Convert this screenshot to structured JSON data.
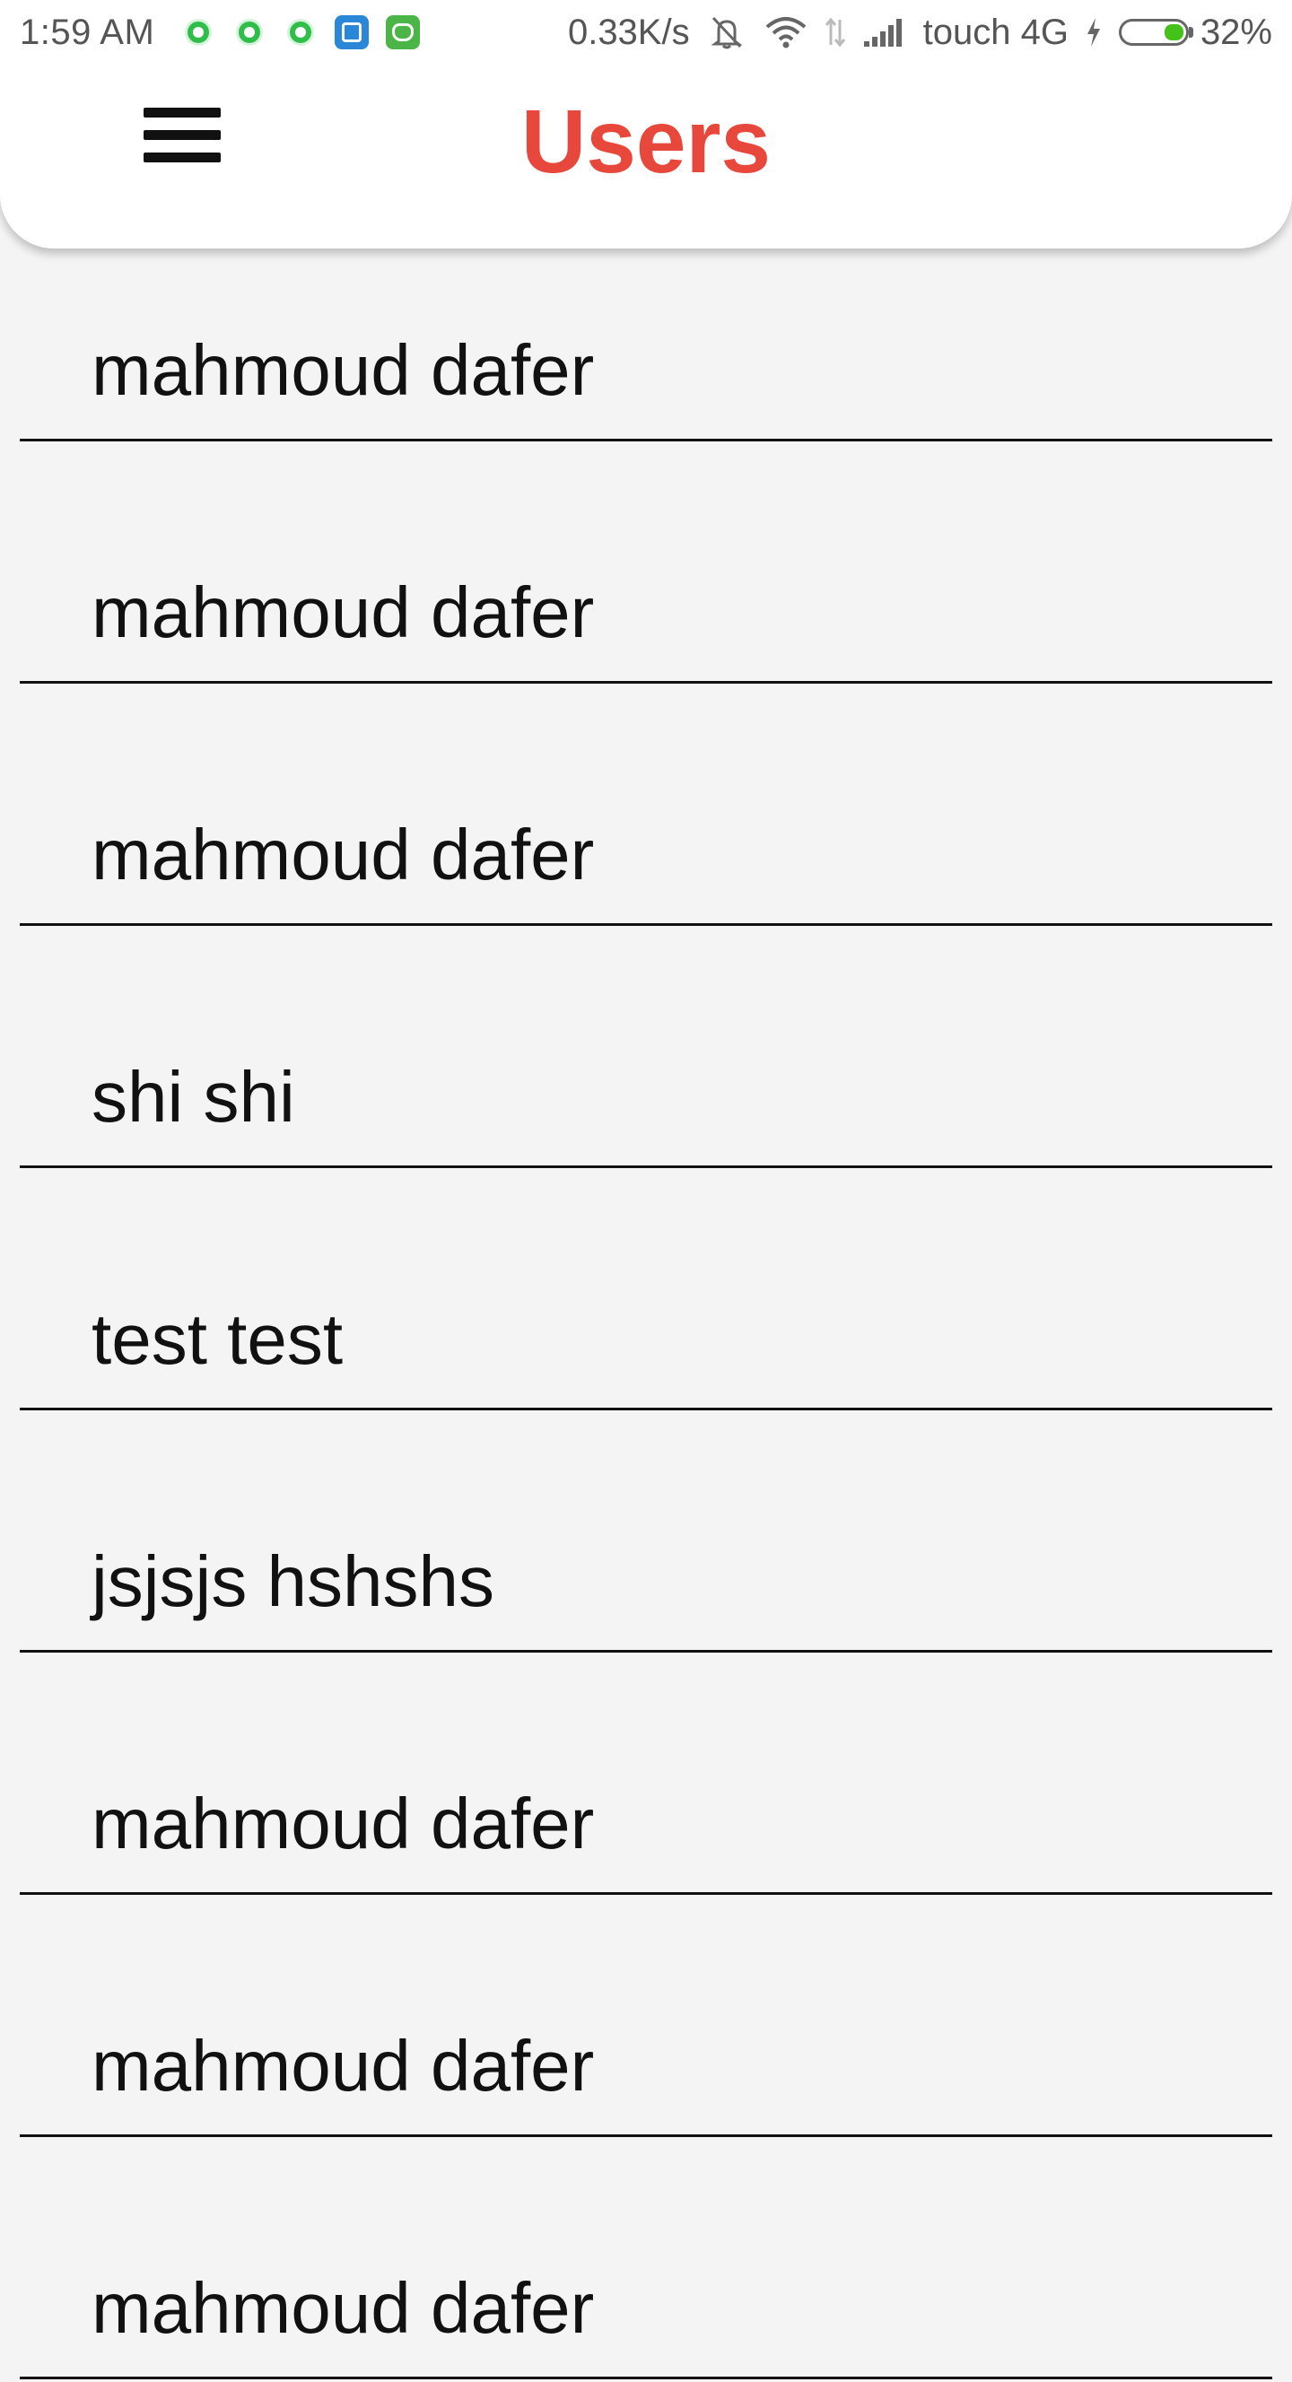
{
  "status_bar": {
    "time": "1:59 AM",
    "apps": [
      "whatsapp-icon",
      "whatsapp-icon",
      "whatsapp-icon",
      "app-store-icon",
      "android-icon"
    ],
    "net_speed": "0.33K/s",
    "carrier": "touch 4G",
    "battery": "32%",
    "battery_level": 0.32
  },
  "app_bar": {
    "title": "Users",
    "menu_icon": "hamburger-menu-icon",
    "title_color": "#e8473b"
  },
  "users": [
    {
      "name": "mahmoud dafer"
    },
    {
      "name": "mahmoud dafer"
    },
    {
      "name": "mahmoud dafer"
    },
    {
      "name": "shi shi"
    },
    {
      "name": "test test"
    },
    {
      "name": "jsjsjs hshshs"
    },
    {
      "name": "mahmoud dafer"
    },
    {
      "name": "mahmoud dafer"
    },
    {
      "name": "mahmoud dafer"
    }
  ]
}
